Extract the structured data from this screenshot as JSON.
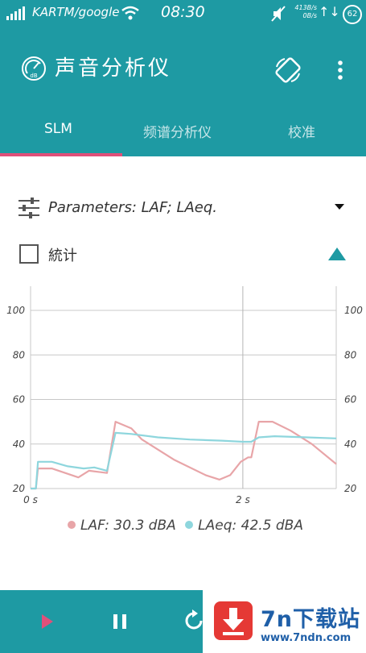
{
  "status_bar": {
    "carrier": "KARTM/google",
    "time": "08:30",
    "net_speed_up": "413B/s",
    "net_speed_down": "0B/s",
    "battery": "62"
  },
  "app_bar": {
    "title": "声音分析仪",
    "logo_icon": "sound-meter-icon",
    "rotate_icon": "screen-rotate-icon",
    "more_icon": "more-vert-icon"
  },
  "tabs": [
    {
      "label": "SLM",
      "active": true
    },
    {
      "label": "频谱分析仪",
      "active": false
    },
    {
      "label": "校准",
      "active": false
    }
  ],
  "parameters": {
    "label": "Parameters: LAF; LAeq."
  },
  "statistics": {
    "label": "統计",
    "checked": false
  },
  "legend": {
    "laf": "LAF: 30.3 dBA",
    "laeq": "LAeq: 42.5 dBA"
  },
  "colors": {
    "accent": "#1e9aa3",
    "indicator": "#e0507a",
    "laf": "#e8a5a8",
    "laeq": "#8ed6dd"
  },
  "chart_data": {
    "type": "line",
    "x_ticks": [
      "0 s",
      "2 s"
    ],
    "y_ticks": [
      "20",
      "40",
      "60",
      "80",
      "100"
    ],
    "ylim": [
      20,
      100
    ],
    "xlim": [
      0,
      2.88
    ],
    "grid": true,
    "series": [
      {
        "name": "LAF",
        "color": "#e8a5a8",
        "points": [
          [
            0.0,
            20
          ],
          [
            0.05,
            20
          ],
          [
            0.07,
            29
          ],
          [
            0.2,
            29
          ],
          [
            0.45,
            25
          ],
          [
            0.55,
            28
          ],
          [
            0.72,
            27
          ],
          [
            0.8,
            50
          ],
          [
            0.95,
            47
          ],
          [
            1.05,
            42
          ],
          [
            1.35,
            33
          ],
          [
            1.65,
            26
          ],
          [
            1.78,
            24
          ],
          [
            1.88,
            26
          ],
          [
            1.98,
            32
          ],
          [
            2.05,
            34
          ],
          [
            2.08,
            34
          ],
          [
            2.15,
            50
          ],
          [
            2.28,
            50
          ],
          [
            2.45,
            46
          ],
          [
            2.65,
            40
          ],
          [
            2.88,
            31
          ]
        ]
      },
      {
        "name": "LAeq",
        "color": "#8ed6dd",
        "points": [
          [
            0.0,
            20
          ],
          [
            0.05,
            20
          ],
          [
            0.07,
            32
          ],
          [
            0.2,
            32
          ],
          [
            0.35,
            30
          ],
          [
            0.5,
            29
          ],
          [
            0.6,
            29.5
          ],
          [
            0.72,
            28
          ],
          [
            0.8,
            45
          ],
          [
            0.95,
            44.5
          ],
          [
            1.2,
            43
          ],
          [
            1.5,
            42
          ],
          [
            1.8,
            41.5
          ],
          [
            2.0,
            41
          ],
          [
            2.08,
            41
          ],
          [
            2.15,
            43
          ],
          [
            2.3,
            43.5
          ],
          [
            2.6,
            43
          ],
          [
            2.88,
            42.5
          ]
        ]
      }
    ]
  }
}
